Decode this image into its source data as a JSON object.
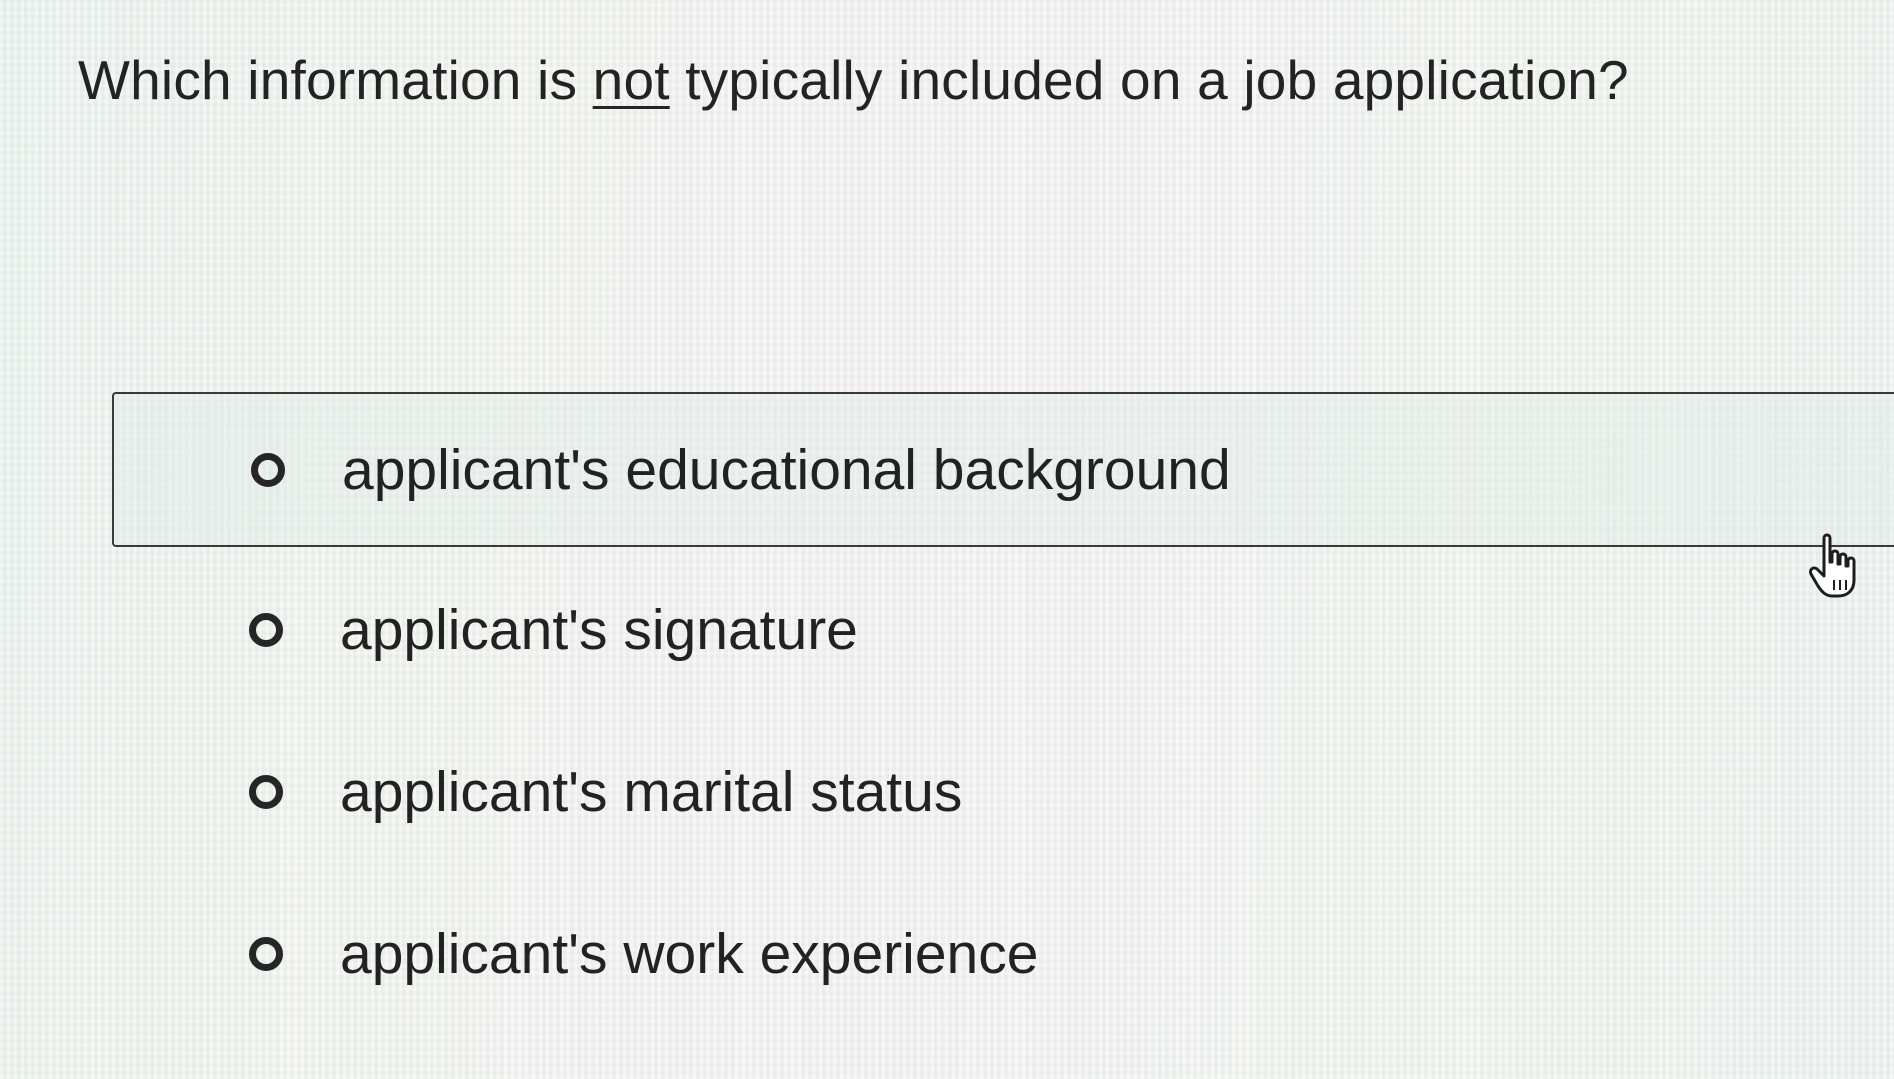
{
  "question": {
    "before": "Which information is ",
    "emphasis": "not",
    "after": " typically included on a job application?"
  },
  "options": [
    {
      "label": "applicant's educational background"
    },
    {
      "label": "applicant's signature"
    },
    {
      "label": "applicant's marital status"
    },
    {
      "label": "applicant's work experience"
    }
  ],
  "cursor": {
    "icon": "hand-pointer-icon"
  }
}
